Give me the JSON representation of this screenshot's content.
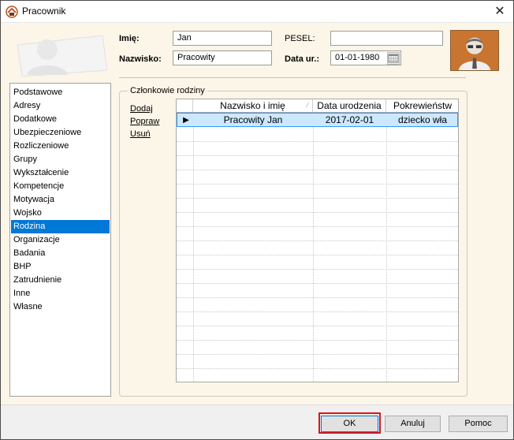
{
  "window": {
    "title": "Pracownik"
  },
  "header": {
    "first_name_label": "Imię:",
    "first_name_value": "Jan",
    "last_name_label": "Nazwisko:",
    "last_name_value": "Pracowity",
    "pesel_label": "PESEL:",
    "pesel_value": "",
    "birthdate_label": "Data ur.:",
    "birthdate_value": "01-01-1980"
  },
  "sidebar": {
    "items": [
      {
        "label": "Podstawowe"
      },
      {
        "label": "Adresy"
      },
      {
        "label": "Dodatkowe"
      },
      {
        "label": "Ubezpieczeniowe"
      },
      {
        "label": "Rozliczeniowe"
      },
      {
        "label": "Grupy"
      },
      {
        "label": "Wykształcenie"
      },
      {
        "label": "Kompetencje"
      },
      {
        "label": "Motywacja"
      },
      {
        "label": "Wojsko"
      },
      {
        "label": "Rodzina"
      },
      {
        "label": "Organizacje"
      },
      {
        "label": "Badania"
      },
      {
        "label": "BHP"
      },
      {
        "label": "Zatrudnienie"
      },
      {
        "label": "Inne"
      },
      {
        "label": "Własne"
      }
    ],
    "selected": "Rodzina"
  },
  "family": {
    "group_title": "Członkowie rodziny",
    "actions": {
      "add": "Dodaj",
      "edit": "Popraw",
      "delete": "Usuń"
    },
    "columns": [
      "Nazwisko i imię",
      "Data urodzenia",
      "Pokrewieństw"
    ],
    "rows": [
      {
        "name": "Pracowity Jan",
        "birthdate": "2017-02-01",
        "relation": "dziecko wła"
      }
    ]
  },
  "footer": {
    "ok": "OK",
    "cancel": "Anuluj",
    "help": "Pomoc"
  }
}
